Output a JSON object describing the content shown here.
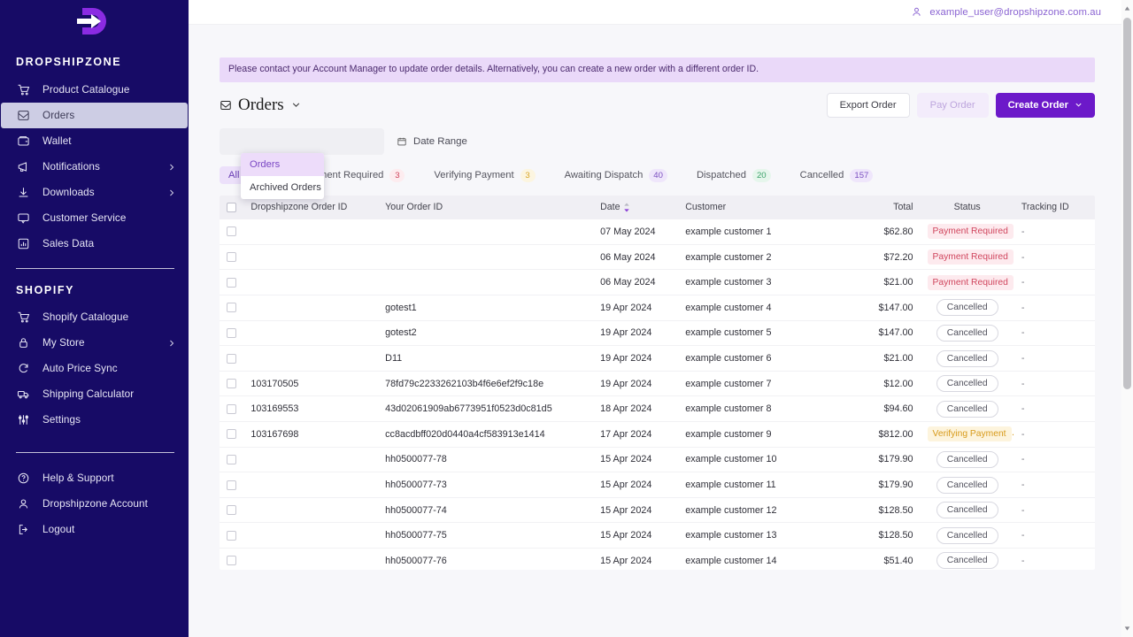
{
  "brand": {
    "logo_icon": "dropshipzone-d-arrow-logo",
    "name": "DROPSHIPZONE",
    "section_shopify": "SHOPIFY"
  },
  "colors": {
    "sidebar_bg": "#170b66",
    "accent_purple": "#6c19c9",
    "banner_bg": "#ead9f9",
    "status_payment_required": "#d0455d",
    "status_verifying": "#d79a1a",
    "status_cancelled": "#50505c",
    "active_nav_bg": "#cdcde4"
  },
  "sidebar": {
    "main_items": [
      {
        "label": "Product Catalogue",
        "icon": "cart-icon",
        "active": false,
        "expandable": false
      },
      {
        "label": "Orders",
        "icon": "inbox-icon",
        "active": true,
        "expandable": false
      },
      {
        "label": "Wallet",
        "icon": "wallet-icon",
        "active": false,
        "expandable": false
      },
      {
        "label": "Notifications",
        "icon": "megaphone-icon",
        "active": false,
        "expandable": true
      },
      {
        "label": "Downloads",
        "icon": "download-icon",
        "active": false,
        "expandable": true
      },
      {
        "label": "Customer Service",
        "icon": "chat-icon",
        "active": false,
        "expandable": false
      },
      {
        "label": "Sales Data",
        "icon": "bar-chart-icon",
        "active": false,
        "expandable": false
      }
    ],
    "shopify_items": [
      {
        "label": "Shopify Catalogue",
        "icon": "cart-icon",
        "expandable": false
      },
      {
        "label": "My Store",
        "icon": "lock-icon",
        "expandable": true
      },
      {
        "label": "Auto Price Sync",
        "icon": "refresh-icon",
        "expandable": false
      },
      {
        "label": "Shipping Calculator",
        "icon": "truck-icon",
        "expandable": false
      },
      {
        "label": "Settings",
        "icon": "sliders-icon",
        "expandable": false
      }
    ],
    "footer_items": [
      {
        "label": "Help & Support",
        "icon": "question-circle-icon"
      },
      {
        "label": "Dropshipzone Account",
        "icon": "user-icon"
      },
      {
        "label": "Logout",
        "icon": "logout-icon"
      }
    ]
  },
  "topbar": {
    "user_icon": "user-icon",
    "user_email": "example_user@dropshipzone.com.au"
  },
  "banner": {
    "text": "Please contact your Account Manager to update order details. Alternatively, you can create a new order with a different order ID."
  },
  "page": {
    "title_icon": "inbox-icon",
    "title": "Orders",
    "chevron_icon": "chevron-down-icon"
  },
  "title_dropdown": {
    "open": true,
    "items": [
      {
        "label": "Orders",
        "selected": true
      },
      {
        "label": "Archived Orders",
        "selected": false
      }
    ]
  },
  "toolbar": {
    "export_label": "Export Order",
    "pay_label": "Pay Order",
    "create_label": "Create Order",
    "create_chevron_icon": "chevron-down-icon"
  },
  "search": {
    "placeholder": "",
    "value": "",
    "date_range_label": "Date Range",
    "calendar_icon": "calendar-icon"
  },
  "tabs": [
    {
      "label": "All Orders",
      "count": "",
      "active": true,
      "badge_fg": "",
      "badge_bg": ""
    },
    {
      "label": "Payment Required",
      "count": "3",
      "active": false,
      "badge_fg": "#d0455d",
      "badge_bg": "#fdecef"
    },
    {
      "label": "Verifying Payment",
      "count": "3",
      "active": false,
      "badge_fg": "#d9a62a",
      "badge_bg": "#fcf5e0"
    },
    {
      "label": "Awaiting Dispatch",
      "count": "40",
      "active": false,
      "badge_fg": "#7b4fc0",
      "badge_bg": "#efe6fb"
    },
    {
      "label": "Dispatched",
      "count": "20",
      "active": false,
      "badge_fg": "#3da36b",
      "badge_bg": "#e6f6ec"
    },
    {
      "label": "Cancelled",
      "count": "157",
      "active": false,
      "badge_fg": "#7b4fc0",
      "badge_bg": "#efe6fb"
    }
  ],
  "table": {
    "select_all_checked": false,
    "sort_column": "Date",
    "sort_direction": "desc",
    "columns": [
      "Dropshipzone Order ID",
      "Your Order ID",
      "Date",
      "Customer",
      "Total",
      "Status",
      "Tracking ID"
    ],
    "rows": [
      {
        "dsz_id": "",
        "your_id": "",
        "date": "07 May 2024",
        "customer": "example customer 1",
        "total": "$62.80",
        "status": "Payment Required",
        "status_type": "required",
        "tracking": "-"
      },
      {
        "dsz_id": "",
        "your_id": "",
        "date": "06 May 2024",
        "customer": "example customer 2",
        "total": "$72.20",
        "status": "Payment Required",
        "status_type": "required",
        "tracking": "-"
      },
      {
        "dsz_id": "",
        "your_id": "",
        "date": "06 May 2024",
        "customer": "example customer 3",
        "total": "$21.00",
        "status": "Payment Required",
        "status_type": "required",
        "tracking": "-"
      },
      {
        "dsz_id": "",
        "your_id": "gotest1",
        "date": "19 Apr 2024",
        "customer": "example customer 4",
        "total": "$147.00",
        "status": "Cancelled",
        "status_type": "cancelled",
        "tracking": "-"
      },
      {
        "dsz_id": "",
        "your_id": "gotest2",
        "date": "19 Apr 2024",
        "customer": "example customer 5",
        "total": "$147.00",
        "status": "Cancelled",
        "status_type": "cancelled",
        "tracking": "-"
      },
      {
        "dsz_id": "",
        "your_id": "D11",
        "date": "19 Apr 2024",
        "customer": "example customer 6",
        "total": "$21.00",
        "status": "Cancelled",
        "status_type": "cancelled",
        "tracking": "-"
      },
      {
        "dsz_id": "103170505",
        "your_id": "78fd79c2233262103b4f6e6ef2f9c18e",
        "date": "19 Apr 2024",
        "customer": "example customer 7",
        "total": "$12.00",
        "status": "Cancelled",
        "status_type": "cancelled",
        "tracking": "-"
      },
      {
        "dsz_id": "103169553",
        "your_id": "43d02061909ab6773951f0523d0c81d5",
        "date": "18 Apr 2024",
        "customer": "example customer 8",
        "total": "$94.60",
        "status": "Cancelled",
        "status_type": "cancelled",
        "tracking": "-"
      },
      {
        "dsz_id": "103167698",
        "your_id": "cc8acdbff020d0440a4cf583913e1414",
        "date": "17 Apr 2024",
        "customer": "example customer 9",
        "total": "$812.00",
        "status": "Verifying Payment",
        "status_type": "verifying",
        "tracking": "-"
      },
      {
        "dsz_id": "",
        "your_id": "hh0500077-78",
        "date": "15 Apr 2024",
        "customer": "example customer 10",
        "total": "$179.90",
        "status": "Cancelled",
        "status_type": "cancelled",
        "tracking": "-"
      },
      {
        "dsz_id": "",
        "your_id": "hh0500077-73",
        "date": "15 Apr 2024",
        "customer": "example customer 11",
        "total": "$179.90",
        "status": "Cancelled",
        "status_type": "cancelled",
        "tracking": "-"
      },
      {
        "dsz_id": "",
        "your_id": "hh0500077-74",
        "date": "15 Apr 2024",
        "customer": "example customer 12",
        "total": "$128.50",
        "status": "Cancelled",
        "status_type": "cancelled",
        "tracking": "-"
      },
      {
        "dsz_id": "",
        "your_id": "hh0500077-75",
        "date": "15 Apr 2024",
        "customer": "example customer 13",
        "total": "$128.50",
        "status": "Cancelled",
        "status_type": "cancelled",
        "tracking": "-"
      },
      {
        "dsz_id": "",
        "your_id": "hh0500077-76",
        "date": "15 Apr 2024",
        "customer": "example customer 14",
        "total": "$51.40",
        "status": "Cancelled",
        "status_type": "cancelled",
        "tracking": "-"
      }
    ]
  },
  "scrollbar": {
    "orientation": "vertical",
    "position_percent": 3
  }
}
